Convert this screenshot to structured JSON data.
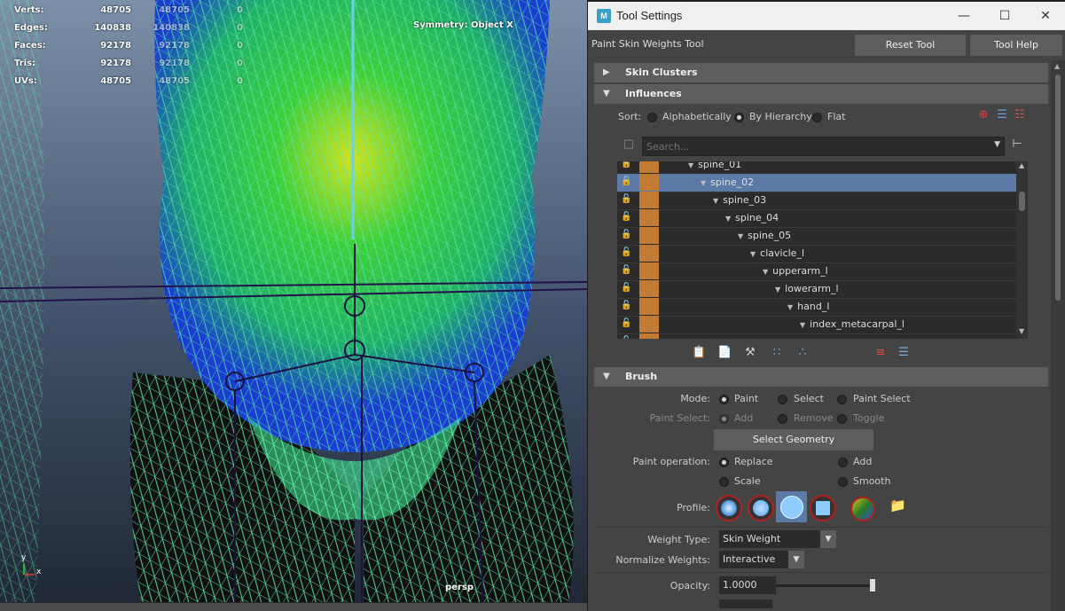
{
  "viewport": {
    "hud": [
      {
        "label": "Verts:",
        "v1": "48705",
        "v2": "48705",
        "v3": "0"
      },
      {
        "label": "Edges:",
        "v1": "140838",
        "v2": "140838",
        "v3": "0"
      },
      {
        "label": "Faces:",
        "v1": "92178",
        "v2": "92178",
        "v3": "0"
      },
      {
        "label": "Tris:",
        "v1": "92178",
        "v2": "92178",
        "v3": "0"
      },
      {
        "label": "UVs:",
        "v1": "48705",
        "v2": "48705",
        "v3": "0"
      }
    ],
    "symmetry": "Symmetry: Object X",
    "camera": "persp",
    "axis_x": "x",
    "axis_y": "y"
  },
  "window": {
    "app_icon": "M",
    "title": "Tool Settings",
    "minimize": "—",
    "maximize": "☐",
    "close": "✕"
  },
  "tool": {
    "name": "Paint Skin Weights Tool",
    "reset_label": "Reset Tool",
    "help_label": "Tool Help"
  },
  "sections": {
    "skin_clusters": "Skin Clusters",
    "influences": "Influences",
    "brush": "Brush"
  },
  "influences": {
    "sort_label": "Sort:",
    "sort_options": [
      "Alphabetically",
      "By Hierarchy",
      "Flat"
    ],
    "sort_selected": "By Hierarchy",
    "search_placeholder": "Search...",
    "joints": [
      {
        "name": "spine_01",
        "depth": 0,
        "selected": false
      },
      {
        "name": "spine_02",
        "depth": 1,
        "selected": true
      },
      {
        "name": "spine_03",
        "depth": 2,
        "selected": false
      },
      {
        "name": "spine_04",
        "depth": 3,
        "selected": false
      },
      {
        "name": "spine_05",
        "depth": 4,
        "selected": false
      },
      {
        "name": "clavicle_l",
        "depth": 5,
        "selected": false
      },
      {
        "name": "upperarm_l",
        "depth": 6,
        "selected": false
      },
      {
        "name": "lowerarm_l",
        "depth": 7,
        "selected": false
      },
      {
        "name": "hand_l",
        "depth": 8,
        "selected": false
      },
      {
        "name": "index_metacarpal_l",
        "depth": 9,
        "selected": false
      }
    ]
  },
  "brush": {
    "mode_label": "Mode:",
    "mode_options": [
      "Paint",
      "Select",
      "Paint Select"
    ],
    "mode_selected": "Paint",
    "paint_select_label": "Paint Select:",
    "paint_select_options": [
      "Add",
      "Remove",
      "Toggle"
    ],
    "select_geometry": "Select Geometry",
    "paint_op_label": "Paint operation:",
    "paint_ops": [
      "Replace",
      "Add",
      "Scale",
      "Smooth"
    ],
    "paint_op_selected": "Replace",
    "profile_label": "Profile:",
    "weight_type_label": "Weight Type:",
    "weight_type": "Skin Weight",
    "normalize_label": "Normalize Weights:",
    "normalize": "Interactive",
    "opacity_label": "Opacity:",
    "opacity": "1.0000",
    "opacity_level": 1.0
  }
}
